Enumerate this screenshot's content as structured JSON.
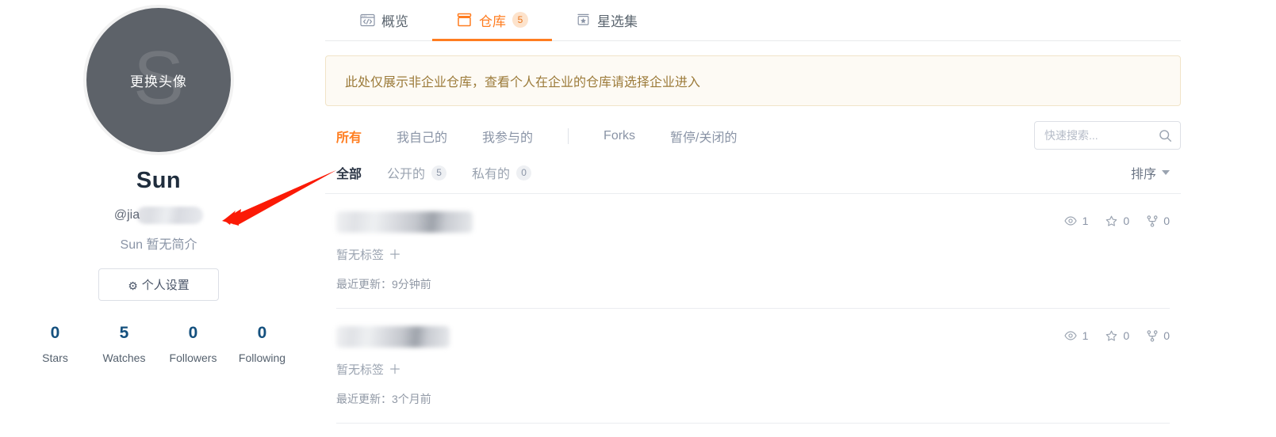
{
  "profile": {
    "avatar": {
      "letter": "S",
      "overlay_label": "更换头像",
      "background_color": "#5d6269"
    },
    "name": "Sun",
    "login_prefix": "@jia",
    "login_redacted": true,
    "bio": "Sun 暂无简介",
    "settings_button": "个人设置",
    "stats": [
      {
        "value": "0",
        "label": "Stars"
      },
      {
        "value": "5",
        "label": "Watches"
      },
      {
        "value": "0",
        "label": "Followers"
      },
      {
        "value": "0",
        "label": "Following"
      }
    ]
  },
  "annotation": {
    "type": "arrow",
    "color": "#fb1a06",
    "points_to": "profile-login"
  },
  "tabs": [
    {
      "label": "概览",
      "icon": "code-window-icon",
      "badge": null,
      "active": false
    },
    {
      "label": "仓库",
      "icon": "repository-box-icon",
      "badge": "5",
      "active": true
    },
    {
      "label": "星选集",
      "icon": "star-box-icon",
      "badge": null,
      "active": false
    }
  ],
  "notice": {
    "text": "此处仅展示非企业仓库，查看个人在企业的仓库请选择企业进入",
    "background": "#fdfaf4",
    "border": "#f1e4c8",
    "text_color": "#9c7b3a"
  },
  "filters": [
    {
      "label": "所有",
      "active": true
    },
    {
      "label": "我自己的",
      "active": false
    },
    {
      "label": "我参与的",
      "active": false
    },
    {
      "label": "Forks",
      "active": false
    },
    {
      "label": "暂停/关闭的",
      "active": false
    }
  ],
  "search": {
    "placeholder": "快速搜索...",
    "value": ""
  },
  "scopes": [
    {
      "label": "全部",
      "count": null,
      "active": true
    },
    {
      "label": "公开的",
      "count": "5",
      "active": false
    },
    {
      "label": "私有的",
      "count": "0",
      "active": false
    }
  ],
  "sort": {
    "label": "排序"
  },
  "repos": [
    {
      "name_redacted": true,
      "tags_label": "暂无标签",
      "add_tag_symbol": "＋",
      "updated": "最近更新：9分钟前",
      "watches": "1",
      "stars": "0",
      "forks": "0"
    },
    {
      "name_redacted": true,
      "tags_label": "暂无标签",
      "add_tag_symbol": "＋",
      "updated": "最近更新：3个月前",
      "watches": "1",
      "stars": "0",
      "forks": "0"
    }
  ],
  "theme": {
    "accent": "#ff7d20",
    "stat_number_color": "#14507e",
    "muted_text": "#9aa3b0"
  }
}
